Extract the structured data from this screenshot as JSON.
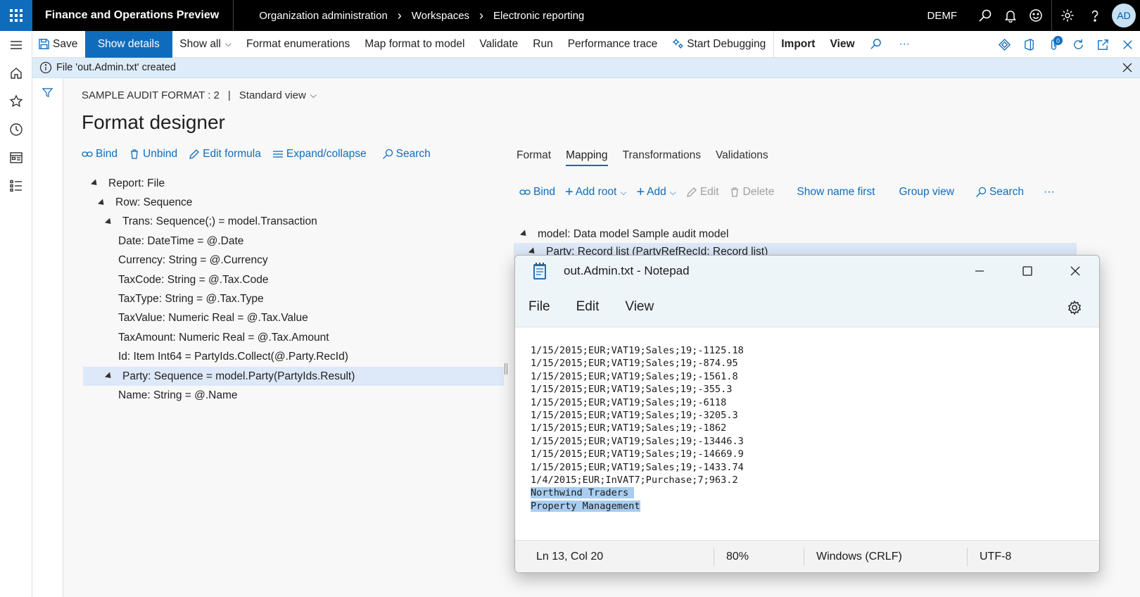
{
  "topbar": {
    "app_title": "Finance and Operations Preview",
    "breadcrumbs": [
      "Organization administration",
      "Workspaces",
      "Electronic reporting"
    ],
    "company": "DEMF",
    "avatar_initials": "AD"
  },
  "actionbar": {
    "save": "Save",
    "show_details": "Show details",
    "show_all": "Show all",
    "format_enumerations": "Format enumerations",
    "map_format_to_model": "Map format to model",
    "validate": "Validate",
    "run": "Run",
    "performance_trace": "Performance trace",
    "start_debugging": "Start Debugging",
    "import": "Import",
    "view": "View",
    "more": "···",
    "notification_count": "0"
  },
  "message": {
    "text": "File 'out.Admin.txt' created"
  },
  "page": {
    "format_name": "SAMPLE AUDIT FORMAT : 2",
    "separator": "|",
    "view_name": "Standard view",
    "title": "Format designer"
  },
  "format_tools": {
    "bind": "Bind",
    "unbind": "Unbind",
    "edit_formula": "Edit formula",
    "expand_collapse": "Expand/collapse",
    "search": "Search"
  },
  "format_tree": [
    {
      "label": "Report: File",
      "indent": 0,
      "toggle": true
    },
    {
      "label": "Row: Sequence",
      "indent": 1,
      "toggle": true
    },
    {
      "label": "Trans: Sequence(;) = model.Transaction",
      "indent": 2,
      "toggle": true
    },
    {
      "label": "Date: DateTime = @.Date",
      "indent": 3,
      "toggle": false
    },
    {
      "label": "Currency: String = @.Currency",
      "indent": 3,
      "toggle": false
    },
    {
      "label": "TaxCode: String = @.Tax.Code",
      "indent": 3,
      "toggle": false
    },
    {
      "label": "TaxType: String = @.Tax.Type",
      "indent": 3,
      "toggle": false
    },
    {
      "label": "TaxValue: Numeric Real = @.Tax.Value",
      "indent": 3,
      "toggle": false
    },
    {
      "label": "TaxAmount: Numeric Real = @.Tax.Amount",
      "indent": 3,
      "toggle": false
    },
    {
      "label": "Id: Item Int64 = PartyIds.Collect(@.Party.RecId)",
      "indent": 3,
      "toggle": false
    },
    {
      "label": "Party: Sequence = model.Party(PartyIds.Result)",
      "indent": 2,
      "toggle": true,
      "selected": true
    },
    {
      "label": "Name: String = @.Name",
      "indent": 3,
      "toggle": false
    }
  ],
  "tabs": [
    "Format",
    "Mapping",
    "Transformations",
    "Validations"
  ],
  "active_tab": "Mapping",
  "mapping_tools": {
    "bind": "Bind",
    "add_root": "Add root",
    "add": "Add",
    "edit": "Edit",
    "delete": "Delete",
    "show_name_first": "Show name first",
    "group_view": "Group view",
    "search": "Search",
    "more": "···"
  },
  "model_tree": {
    "root": "model: Data model Sample audit model",
    "child": "Party: Record list (PartyRefRecId: Record list)"
  },
  "notepad": {
    "title": "out.Admin.txt - Notepad",
    "menu": [
      "File",
      "Edit",
      "View"
    ],
    "lines": [
      "1/15/2015;EUR;VAT19;Sales;19;-1125.18",
      "1/15/2015;EUR;VAT19;Sales;19;-874.95",
      "1/15/2015;EUR;VAT19;Sales;19;-1561.8",
      "1/15/2015;EUR;VAT19;Sales;19;-355.3",
      "1/15/2015;EUR;VAT19;Sales;19;-6118",
      "1/15/2015;EUR;VAT19;Sales;19;-3205.3",
      "1/15/2015;EUR;VAT19;Sales;19;-1862",
      "1/15/2015;EUR;VAT19;Sales;19;-13446.3",
      "1/15/2015;EUR;VAT19;Sales;19;-14669.9",
      "1/15/2015;EUR;VAT19;Sales;19;-1433.74",
      "1/4/2015;EUR;InVAT7;Purchase;7;963.2"
    ],
    "selected_lines": [
      "Northwind Traders ",
      "Property Management"
    ],
    "status": {
      "position": "Ln 13, Col 20",
      "zoom": "80%",
      "line_ending": "Windows (CRLF)",
      "encoding": "UTF-8"
    }
  },
  "colors": {
    "accent": "#0f6cbd",
    "message_bg": "#deecf9",
    "selection": "#dde8f8",
    "text_selection": "#a8cdf0"
  }
}
